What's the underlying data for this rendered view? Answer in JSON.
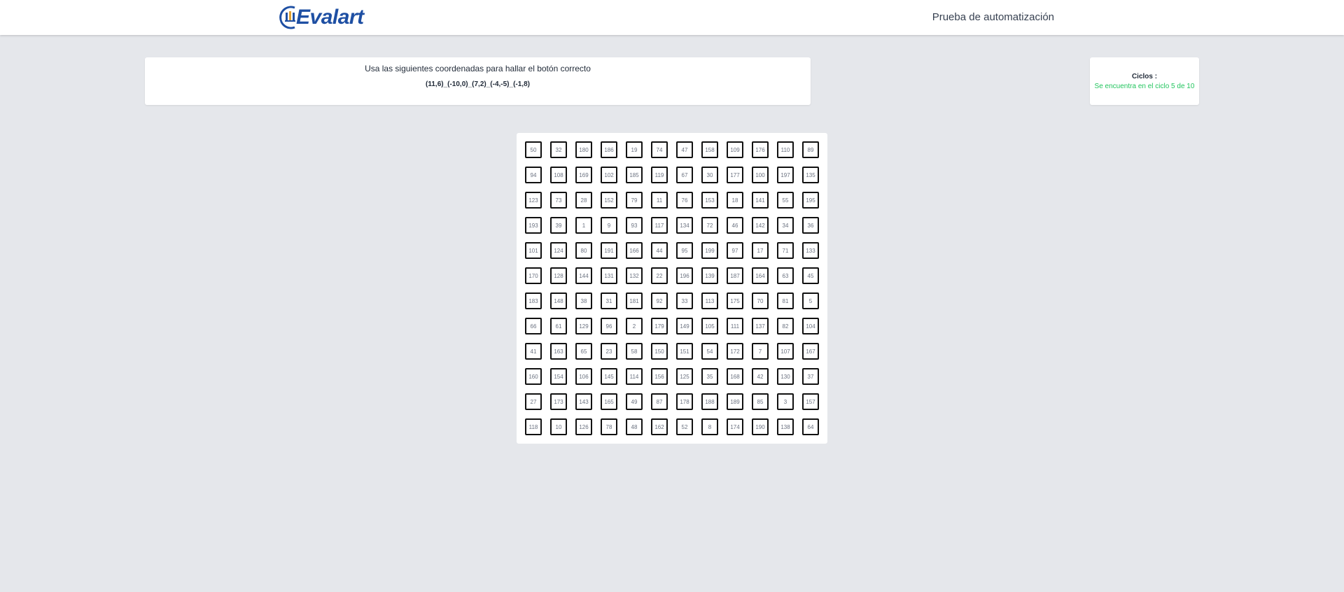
{
  "header": {
    "logo_text": "Evalart",
    "title": "Prueba de automatización"
  },
  "instructions": {
    "text": "Usa las siguientes coordenadas para hallar el botón correcto",
    "coordinates": "(11,6)_(-10,0)_(7,2)_(-4,-5)_(-1,8)"
  },
  "cycles": {
    "label": "Ciclos :",
    "status": "Se encuentra en el ciclo 5 de 10"
  },
  "colors": {
    "logo_blue": "#1e4fa3",
    "status_green": "#22c55e",
    "background": "#e5e7eb"
  },
  "grid": {
    "rows": [
      [
        "50",
        "32",
        "180",
        "186",
        "19",
        "74",
        "47",
        "158",
        "109",
        "176",
        "110",
        "89"
      ],
      [
        "94",
        "108",
        "169",
        "102",
        "185",
        "119",
        "67",
        "30",
        "177",
        "100",
        "197",
        "135"
      ],
      [
        "123",
        "73",
        "28",
        "152",
        "79",
        "11",
        "76",
        "153",
        "18",
        "141",
        "55",
        "195"
      ],
      [
        "193",
        "39",
        "1",
        "9",
        "93",
        "117",
        "134",
        "72",
        "46",
        "142",
        "34",
        "36"
      ],
      [
        "101",
        "124",
        "80",
        "191",
        "166",
        "44",
        "95",
        "199",
        "97",
        "17",
        "71",
        "133"
      ],
      [
        "170",
        "128",
        "144",
        "131",
        "132",
        "22",
        "196",
        "139",
        "187",
        "164",
        "63",
        "45"
      ],
      [
        "183",
        "148",
        "38",
        "31",
        "181",
        "92",
        "33",
        "113",
        "175",
        "70",
        "81",
        "5"
      ],
      [
        "66",
        "61",
        "129",
        "96",
        "2",
        "179",
        "149",
        "105",
        "111",
        "137",
        "82",
        "104"
      ],
      [
        "41",
        "163",
        "65",
        "23",
        "58",
        "150",
        "151",
        "54",
        "172",
        "7",
        "107",
        "167"
      ],
      [
        "160",
        "154",
        "106",
        "145",
        "114",
        "156",
        "125",
        "35",
        "168",
        "42",
        "130",
        "37"
      ],
      [
        "27",
        "173",
        "143",
        "165",
        "49",
        "87",
        "178",
        "188",
        "189",
        "85",
        "3",
        "157"
      ],
      [
        "118",
        "10",
        "126",
        "78",
        "48",
        "162",
        "52",
        "8",
        "174",
        "190",
        "138",
        "64"
      ]
    ]
  }
}
